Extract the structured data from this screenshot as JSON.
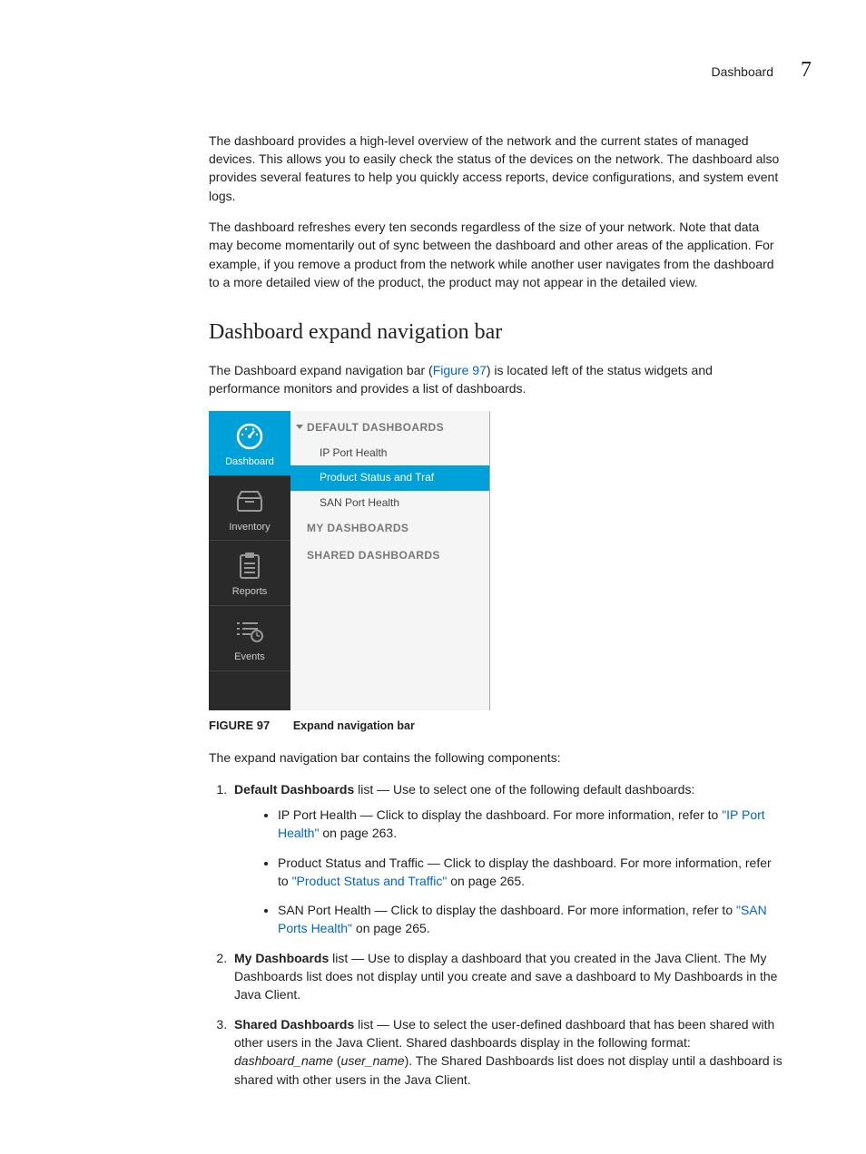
{
  "header": {
    "label": "Dashboard",
    "chapter": "7"
  },
  "intro": {
    "p1": "The dashboard provides a high-level overview of the network and the current states of managed devices. This allows you to easily check the status of the devices on the network. The dashboard also provides several features to help you quickly access reports, device configurations, and system event logs.",
    "p2": "The dashboard refreshes every ten seconds regardless of the size of your network. Note that data may become momentarily out of sync between the dashboard and other areas of the application. For example, if you remove a product from the network while another user navigates from the dashboard to a more detailed view of the product, the product may not appear in the detailed view."
  },
  "section": {
    "heading": "Dashboard expand navigation bar",
    "p1a": "The Dashboard expand navigation bar (",
    "p1link": "Figure 97",
    "p1b": ") is located left of the status widgets and performance monitors and provides a list of dashboards."
  },
  "figure": {
    "nav": {
      "dashboard": "Dashboard",
      "inventory": "Inventory",
      "reports": "Reports",
      "events": "Events"
    },
    "panel": {
      "default_header": "DEFAULT DASHBOARDS",
      "item_ip": "IP Port Health",
      "item_product": "Product Status and Traf",
      "item_san": "SAN Port Health",
      "my_header": "MY DASHBOARDS",
      "shared_header": "SHARED DASHBOARDS"
    },
    "caption_label": "FIGURE 97",
    "caption_text": "Expand navigation bar"
  },
  "comp_para": "The expand navigation bar contains the following components:",
  "list": {
    "item1": {
      "lead": "Default Dashboards",
      "rest": " list — Use to select one of the following default dashboards:",
      "b1": {
        "pre": "IP Port Health — Click to display the dashboard. For more information, refer to ",
        "link": "\"IP Port Health\"",
        "post": " on page 263."
      },
      "b2": {
        "pre": "Product Status and Traffic — Click to display the dashboard. For more information, refer to ",
        "link": "\"Product Status and Traffic\"",
        "post": " on page 265."
      },
      "b3": {
        "pre": "SAN Port Health — Click to display the dashboard. For more information, refer to ",
        "link": "\"SAN Ports Health\"",
        "post": " on page 265."
      }
    },
    "item2": {
      "lead": "My Dashboards",
      "rest": " list — Use to display a dashboard that you created in the Java Client. The My Dashboards list does not display until you create and save a dashboard to My Dashboards in the Java Client."
    },
    "item3": {
      "lead": "Shared Dashboards",
      "rest_a": " list — Use to select the user-defined dashboard that has been shared with other users in the Java Client. Shared dashboards display in the following format: ",
      "format1": "dashboard_name",
      "paren_open": " (",
      "format2": "user_name",
      "rest_b": "). The Shared Dashboards list does not display until a dashboard is shared with other users in the Java Client."
    }
  }
}
